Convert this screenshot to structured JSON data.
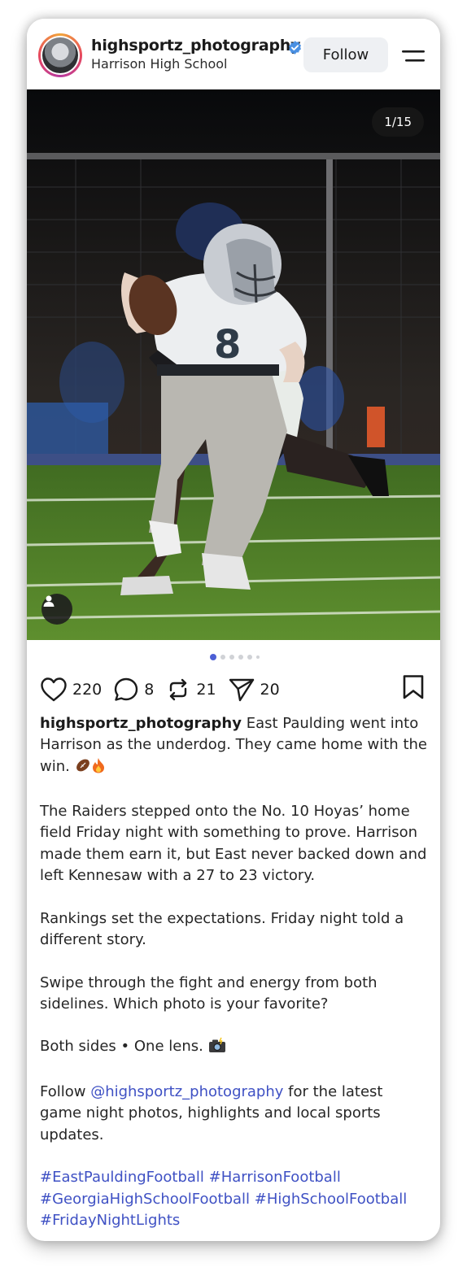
{
  "header": {
    "username": "highsportz_photography",
    "location": "Harrison High School",
    "follow_label": "Follow",
    "verified_color": "#4a90e2"
  },
  "media": {
    "counter": "1/15",
    "slide_index": 1,
    "slide_total": 15,
    "icons": {
      "tag": "person-tag-icon"
    }
  },
  "actions": {
    "likes": "220",
    "comments": "8",
    "reposts": "21",
    "shares": "20"
  },
  "caption": {
    "author": "highsportz_photography",
    "intro": "East Paulding went into Harrison as the underdog. They came home with the win.",
    "p2": "The Raiders stepped onto the No. 10 Hoyas’ home field Friday night with something to prove. Harrison made them earn it, but East never backed down and left Kennesaw with a 27 to 23 victory.",
    "p3": "Rankings set the expectations. Friday night told a different story.",
    "p4": "Swipe through the fight and energy from both sidelines. Which photo is your favorite?",
    "p5": "Both sides • One lens.",
    "p6_pre": "Follow ",
    "p6_mention": "@highsportz_photography",
    "p6_post": " for the latest game night photos, highlights and local sports updates.",
    "hashtags": [
      "#EastPauldingFootball",
      "#HarrisonFootball",
      "#GeorgiaHighSchoolFootball",
      "#HighSchoolFootball",
      "#FridayNightLights"
    ]
  },
  "colors": {
    "link": "#3f51c4",
    "active_dot": "#4c5fd5"
  }
}
